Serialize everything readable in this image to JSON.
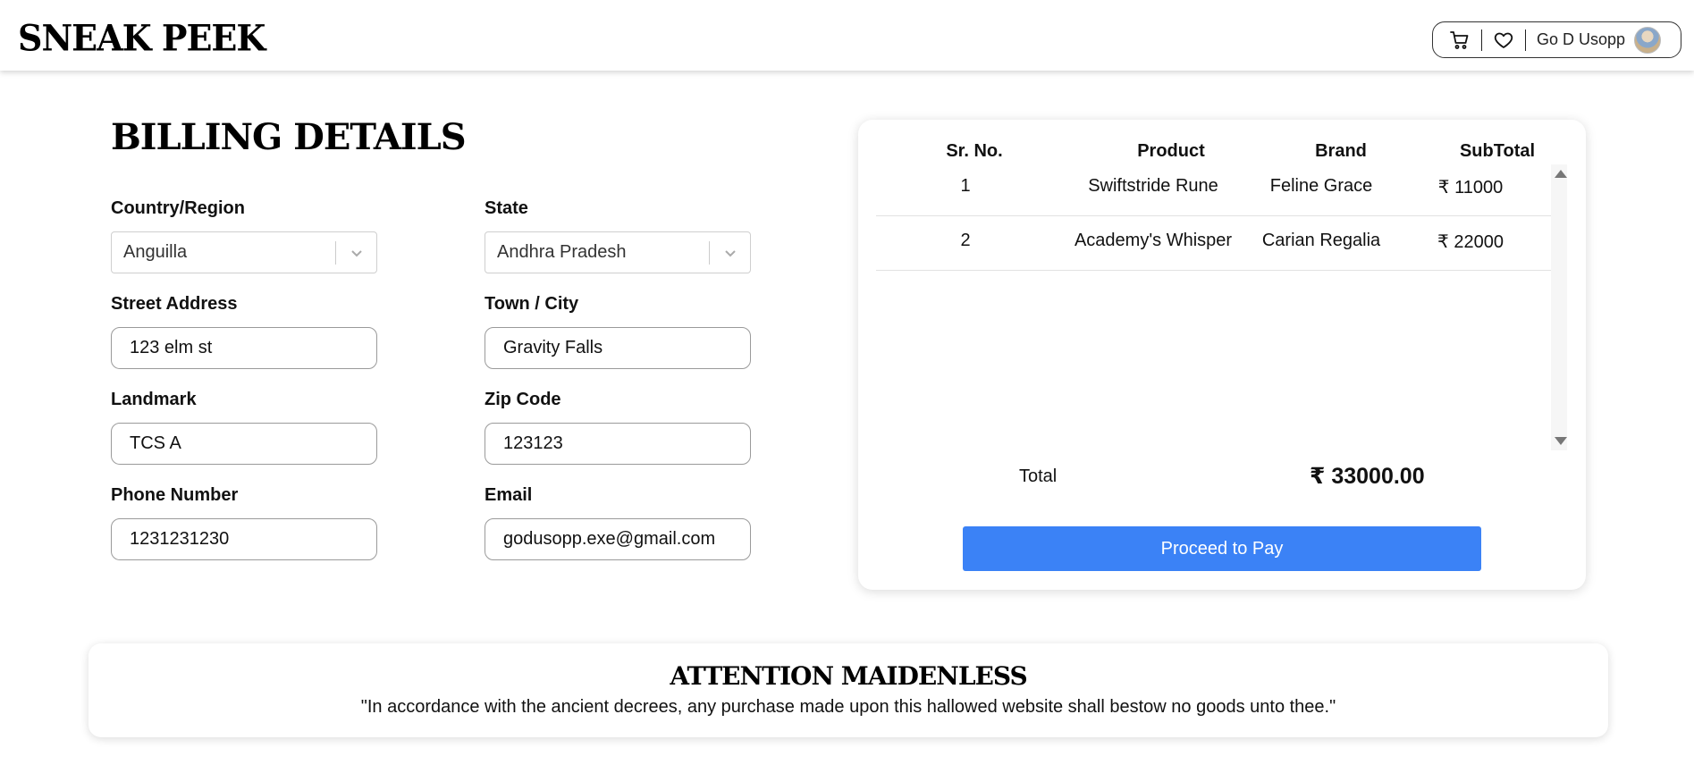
{
  "header": {
    "logo": "SNEAK PEEK",
    "user_name": "Go D Usopp",
    "icons": [
      "cart-icon",
      "heart-icon"
    ]
  },
  "billing": {
    "title": "BILLING DETAILS",
    "country_label": "Country/Region",
    "country_value": "Anguilla",
    "state_label": "State",
    "state_value": "Andhra Pradesh",
    "street_label": "Street Address",
    "street_value": "123 elm st",
    "town_label": "Town / City",
    "town_value": "Gravity Falls",
    "landmark_label": "Landmark",
    "landmark_value": "TCS A",
    "zip_label": "Zip Code",
    "zip_value": "123123",
    "phone_label": "Phone Number",
    "phone_value": "1231231230",
    "email_label": "Email",
    "email_value": "godusopp.exe@gmail.com"
  },
  "order": {
    "columns": [
      "Sr. No.",
      "Product",
      "Brand",
      "SubTotal"
    ],
    "rows": [
      {
        "sr": "1",
        "product": "Swiftstride Rune",
        "brand": "Feline Grace",
        "subtotal": "₹ 11000"
      },
      {
        "sr": "2",
        "product": "Academy's Whisper",
        "brand": "Carian Regalia",
        "subtotal": "₹ 22000"
      }
    ],
    "total_label": "Total",
    "total_value": "₹ 33000.00",
    "pay_button": "Proceed to Pay"
  },
  "banner": {
    "title": "ATTENTION MAIDENLESS",
    "text": "\"In accordance with the ancient decrees, any purchase made upon this hallowed website shall bestow no goods unto thee.\""
  },
  "colors": {
    "accent": "#3b82f6",
    "text": "#111111",
    "border": "#9a9a9a"
  }
}
